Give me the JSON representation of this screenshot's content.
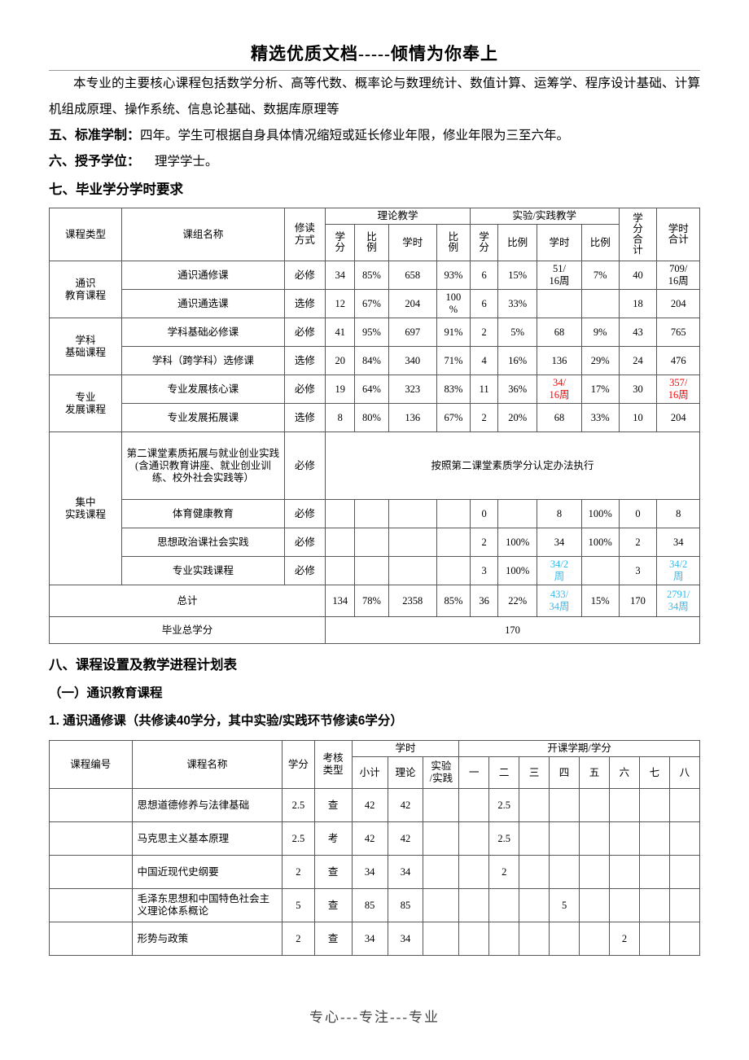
{
  "header": {
    "banner": "精选优质文档-----倾情为你奉上"
  },
  "footer": {
    "text": "专心---专注---专业"
  },
  "body": {
    "para1": "本专业的主要核心课程包括数学分析、高等代数、概率论与数理统计、数值计算、运筹学、程序设计基础、计算机组成原理、操作系统、信息论基础、数据库原理等",
    "item5_label": "五、标准学制：",
    "item5_text": "四年。学生可根据自身具体情况缩短或延长修业年限，修业年限为三至六年。",
    "item6_label": "六、授予学位：",
    "item6_text": "理学学士。",
    "item7_title": "七、毕业学分学时要求",
    "item8_title": "八、课程设置及教学进程计划表",
    "sub1_title": "（一）通识教育课程",
    "sub1_1_title": "1. 通识通修课（共修读40学分，其中实验/实践环节修读6学分）"
  },
  "table1": {
    "headers": {
      "course_type": "课程类型",
      "group_name": "课组名称",
      "study_mode": "修读方式",
      "theory": "理论教学",
      "practice": "实验/实践教学",
      "credit_total": "学分合计",
      "hour_total": "学时合计",
      "credit": "学分",
      "ratio": "比例",
      "hours": "学时"
    },
    "groups": [
      {
        "type": "通识\n教育课程",
        "type_l1": "通识",
        "type_l2": "教育课程",
        "rows": [
          {
            "name": "通识通修课",
            "mode": "必修",
            "t_credit": "34",
            "t_ratio": "85%",
            "t_hours": "658",
            "t_hratio": "93%",
            "p_credit": "6",
            "p_ratio": "15%",
            "p_hours": "51/\n16周",
            "p_hours_l1": "51/",
            "p_hours_l2": "16周",
            "p_hratio": "7%",
            "credit_sum": "40",
            "hour_sum_l1": "709/",
            "hour_sum_l2": "16周"
          },
          {
            "name": "通识通选课",
            "mode": "选修",
            "t_credit": "12",
            "t_ratio": "67%",
            "t_hours": "204",
            "t_hratio": "100\n%",
            "t_hratio_l1": "100",
            "t_hratio_l2": "%",
            "p_credit": "6",
            "p_ratio": "33%",
            "p_hours": "",
            "p_hratio": "",
            "credit_sum": "18",
            "hour_sum_l1": "204",
            "hour_sum_l2": ""
          }
        ]
      },
      {
        "type_l1": "学科",
        "type_l2": "基础课程",
        "rows": [
          {
            "name": "学科基础必修课",
            "mode": "必修",
            "t_credit": "41",
            "t_ratio": "95%",
            "t_hours": "697",
            "t_hratio": "91%",
            "p_credit": "2",
            "p_ratio": "5%",
            "p_hours": "68",
            "p_hratio": "9%",
            "credit_sum": "43",
            "hour_sum_l1": "765",
            "hour_sum_l2": ""
          },
          {
            "name": "学科（跨学科）选修课",
            "mode": "选修",
            "t_credit": "20",
            "t_ratio": "84%",
            "t_hours": "340",
            "t_hratio": "71%",
            "p_credit": "4",
            "p_ratio": "16%",
            "p_hours": "136",
            "p_hratio": "29%",
            "credit_sum": "24",
            "hour_sum_l1": "476",
            "hour_sum_l2": ""
          }
        ]
      },
      {
        "type_l1": "专业",
        "type_l2": "发展课程",
        "rows": [
          {
            "name": "专业发展核心课",
            "mode": "必修",
            "t_credit": "19",
            "t_ratio": "64%",
            "t_hours": "323",
            "t_hratio": "83%",
            "p_credit": "11",
            "p_ratio": "36%",
            "p_hours_l1": "34/",
            "p_hours_l2": "16周",
            "p_hours_red": true,
            "p_hratio": "17%",
            "credit_sum": "30",
            "hour_sum_l1": "357/",
            "hour_sum_l2": "16周",
            "hour_sum_red": true
          },
          {
            "name": "专业发展拓展课",
            "mode": "选修",
            "t_credit": "8",
            "t_ratio": "80%",
            "t_hours": "136",
            "t_hratio": "67%",
            "p_credit": "2",
            "p_ratio": "20%",
            "p_hours": "68",
            "p_hratio": "33%",
            "credit_sum": "10",
            "hour_sum_l1": "204",
            "hour_sum_l2": ""
          }
        ]
      },
      {
        "type_l1": "集中",
        "type_l2": "实践课程",
        "rows": [
          {
            "name": "第二课堂素质拓展与就业创业实践(含通识教育讲座、就业创业训练、校外社会实践等）",
            "mode": "必修",
            "merged_note": "按照第二课堂素质学分认定办法执行"
          },
          {
            "name": "体育健康教育",
            "mode": "必修",
            "t_credit": "",
            "t_ratio": "",
            "t_hours": "",
            "t_hratio": "",
            "p_credit": "0",
            "p_ratio": "",
            "p_hours": "8",
            "p_hratio": "100%",
            "credit_sum": "0",
            "hour_sum_l1": "8",
            "hour_sum_l2": ""
          },
          {
            "name": "思想政治课社会实践",
            "mode": "必修",
            "t_credit": "",
            "t_ratio": "",
            "t_hours": "",
            "t_hratio": "",
            "p_credit": "2",
            "p_ratio": "100%",
            "p_hours": "34",
            "p_hratio": "100%",
            "credit_sum": "2",
            "hour_sum_l1": "34",
            "hour_sum_l2": ""
          },
          {
            "name": "专业实践课程",
            "mode": "必修",
            "t_credit": "",
            "t_ratio": "",
            "t_hours": "",
            "t_hratio": "",
            "p_credit": "3",
            "p_ratio": "100%",
            "p_hours_l1": "34/2",
            "p_hours_l2": "周",
            "p_hours_cyan": true,
            "p_hratio": "",
            "credit_sum": "3",
            "hour_sum_l1": "34/2",
            "hour_sum_l2": "周",
            "hour_sum_cyan": true
          }
        ]
      }
    ],
    "total_row": {
      "label": "总计",
      "t_credit": "134",
      "t_ratio": "78%",
      "t_hours": "2358",
      "t_hratio": "85%",
      "p_credit": "36",
      "p_ratio": "22%",
      "p_hours_l1": "433/",
      "p_hours_l2": "34周",
      "p_hours_cyan": true,
      "p_hratio": "15%",
      "credit_sum": "170",
      "hour_sum_l1": "2791/",
      "hour_sum_l2": "34周",
      "hour_sum_cyan": true
    },
    "grad_row": {
      "label": "毕业总学分",
      "value": "170"
    }
  },
  "table2": {
    "headers": {
      "code": "课程编号",
      "name": "课程名称",
      "credit": "学分",
      "exam_type_l1": "考核",
      "exam_type_l2": "类型",
      "hours": "学时",
      "subtotal": "小计",
      "theory": "理论",
      "practice_l1": "实验",
      "practice_l2": "/实践",
      "semesters": "开课学期/学分",
      "sem_labels": [
        "一",
        "二",
        "三",
        "四",
        "五",
        "六",
        "七",
        "八"
      ]
    },
    "rows": [
      {
        "code": "",
        "name": "思想道德修养与法律基础",
        "credit": "2.5",
        "exam": "查",
        "subtotal": "42",
        "theory": "42",
        "practice": "",
        "sem": [
          "",
          "2.5",
          "",
          "",
          "",
          "",
          "",
          ""
        ]
      },
      {
        "code": "",
        "name": "马克思主义基本原理",
        "credit": "2.5",
        "exam": "考",
        "subtotal": "42",
        "theory": "42",
        "practice": "",
        "sem": [
          "",
          "2.5",
          "",
          "",
          "",
          "",
          "",
          ""
        ]
      },
      {
        "code": "",
        "name": "中国近现代史纲要",
        "credit": "2",
        "exam": "查",
        "subtotal": "34",
        "theory": "34",
        "practice": "",
        "sem": [
          "",
          "2",
          "",
          "",
          "",
          "",
          "",
          ""
        ]
      },
      {
        "code": "",
        "name": "毛泽东思想和中国特色社会主义理论体系概论",
        "credit": "5",
        "exam": "查",
        "subtotal": "85",
        "theory": "85",
        "practice": "",
        "sem": [
          "",
          "",
          "",
          "5",
          "",
          "",
          "",
          ""
        ]
      },
      {
        "code": "",
        "name": "形势与政策",
        "credit": "2",
        "exam": "查",
        "subtotal": "34",
        "theory": "34",
        "practice": "",
        "sem": [
          "",
          "",
          "",
          "",
          "",
          "2",
          "",
          ""
        ]
      }
    ]
  }
}
